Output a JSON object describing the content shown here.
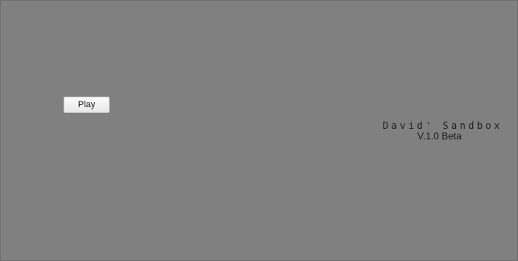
{
  "menu": {
    "play_label": "Play"
  },
  "game": {
    "title": "David' Sandbox",
    "version": "V.1.0 Beta"
  },
  "colors": {
    "background": "#808080",
    "button": "#f0f0f0",
    "text": "#1a1a1a"
  }
}
